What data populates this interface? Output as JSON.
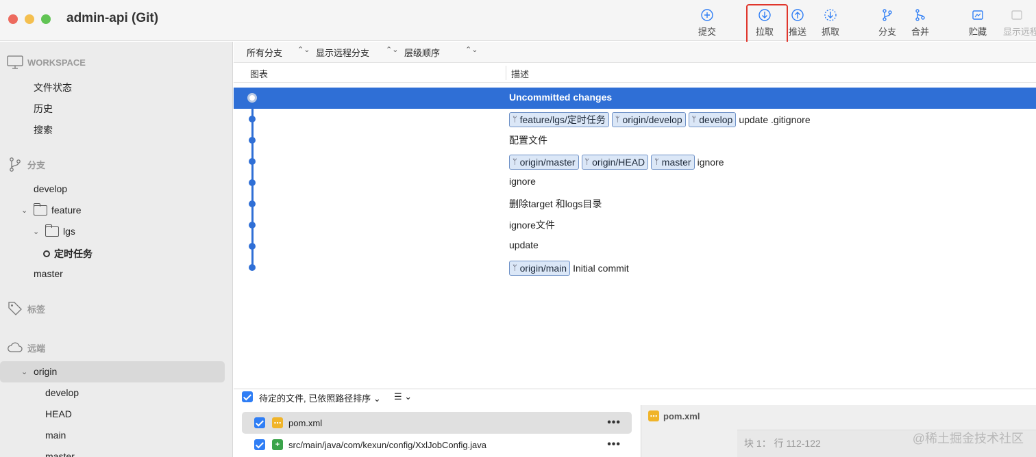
{
  "window": {
    "title": "admin-api (Git)"
  },
  "toolbar": {
    "commit": "提交",
    "pull": "拉取",
    "push": "推送",
    "fetch": "抓取",
    "branch": "分支",
    "merge": "合并",
    "stash": "贮藏",
    "show_remote": "显示远程"
  },
  "sidebar": {
    "workspace": "WORKSPACE",
    "file_status": "文件状态",
    "history": "历史",
    "search": "搜索",
    "branches": "分支",
    "branch_develop": "develop",
    "folder_feature": "feature",
    "folder_lgs": "lgs",
    "branch_current": "定时任务",
    "branch_master": "master",
    "tags": "标签",
    "remotes": "远端",
    "remote_origin": "origin",
    "remote_develop": "develop",
    "remote_head": "HEAD",
    "remote_main": "main",
    "remote_master": "master"
  },
  "filters": {
    "all_branches": "所有分支",
    "show_remote": "显示远程分支",
    "order": "层级顺序"
  },
  "columns": {
    "graph": "图表",
    "description": "描述"
  },
  "commits": [
    {
      "message": "Uncommitted changes",
      "tags": []
    },
    {
      "message": "update .gitignore",
      "tags": [
        "feature/lgs/定时任务",
        "origin/develop",
        "develop"
      ]
    },
    {
      "message": "配置文件",
      "tags": []
    },
    {
      "message": "ignore",
      "tags": [
        "origin/master",
        "origin/HEAD",
        "master"
      ]
    },
    {
      "message": "ignore",
      "tags": []
    },
    {
      "message": "删除target 和logs目录",
      "tags": []
    },
    {
      "message": "ignore文件",
      "tags": []
    },
    {
      "message": "update",
      "tags": []
    },
    {
      "message": "Initial commit",
      "tags": [
        "origin/main"
      ]
    }
  ],
  "staging": {
    "sort_label": "待定的文件, 已依照路径排序",
    "files": [
      {
        "name": "pom.xml",
        "status": "modified"
      },
      {
        "name": "src/main/java/com/kexun/config/XxlJobConfig.java",
        "status": "added"
      }
    ],
    "more": "•••"
  },
  "diff": {
    "file": "pom.xml",
    "hunk": "块 1：  行 112-122"
  },
  "watermark": "@稀土掘金技术社区"
}
